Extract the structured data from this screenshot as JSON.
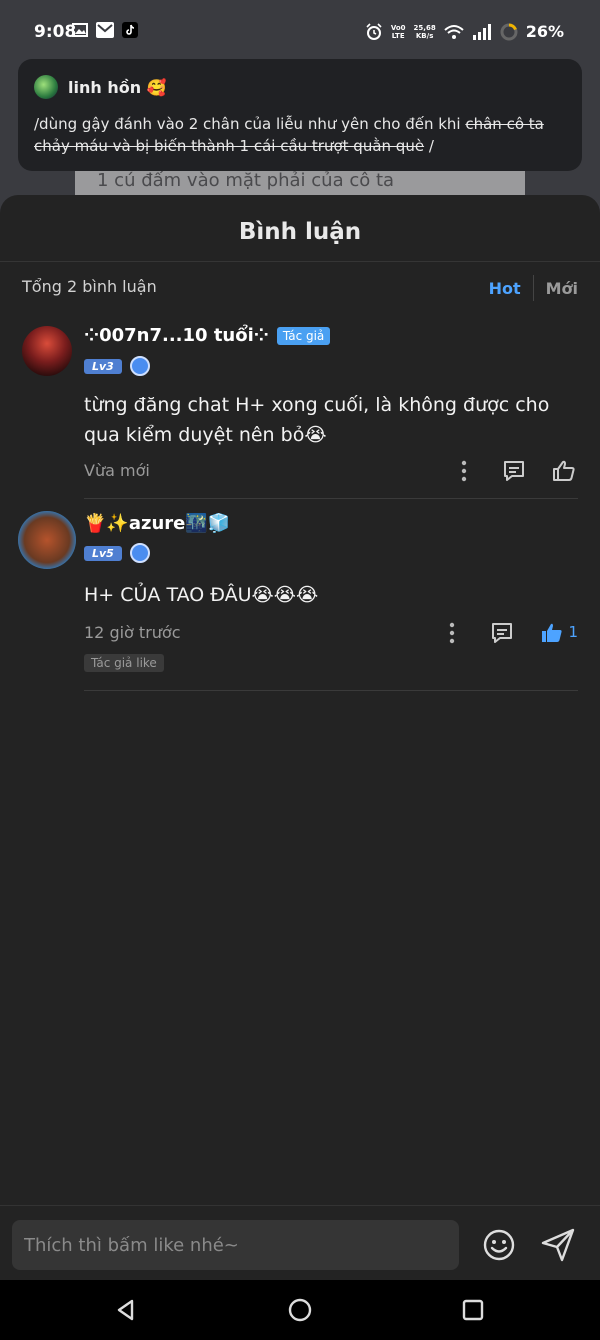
{
  "status_bar": {
    "time": "9:08",
    "battery": "26%",
    "net_speed": "25,68\nKB/s",
    "volte": "Vo0\nLTE",
    "icons": [
      "gallery-icon",
      "mail-icon",
      "tiktok-icon",
      "alarm-icon",
      "volte-icon",
      "wifi-icon",
      "signal-icon",
      "battery-icon"
    ]
  },
  "background": {
    "strip_text": "1 cú đấm vào mặt phải của cô ta"
  },
  "notification": {
    "sender": "linh hồn 🥰",
    "message_plain": "/dùng gậy đánh vào 2 chân của liễu như yên cho đến khi ",
    "message_struck": "chân cô ta chảy máu và bị biến thành 1 cái cầu trượt quằn què",
    "message_end": " /"
  },
  "sheet": {
    "title": "Bình luận",
    "total": "Tổng 2 bình luận",
    "sort_hot": "Hot",
    "sort_new": "Mới"
  },
  "comments": [
    {
      "name": "⁘007n7...10 tuổi⁘",
      "author_tag": "Tác giả",
      "level": "Lv3",
      "text": "từng đăng chat H+ xong cuối, là không được cho qua kiểm duyệt nên bỏ😭",
      "time": "Vừa mới",
      "likes": "",
      "liked": false
    },
    {
      "name": "🍟✨azure🌃🧊",
      "level": "Lv5",
      "text": "H+ CỦA TAO ĐÂU😭😭😭",
      "time": "12 giờ trước",
      "likes": "1",
      "liked": true,
      "author_like": "Tác giả like"
    }
  ],
  "input_bar": {
    "placeholder": "Thích thì bấm like nhé~"
  },
  "colors": {
    "accent": "#4da3ff",
    "sheet_bg": "#232323",
    "author_tag": "#4aa0f2"
  }
}
